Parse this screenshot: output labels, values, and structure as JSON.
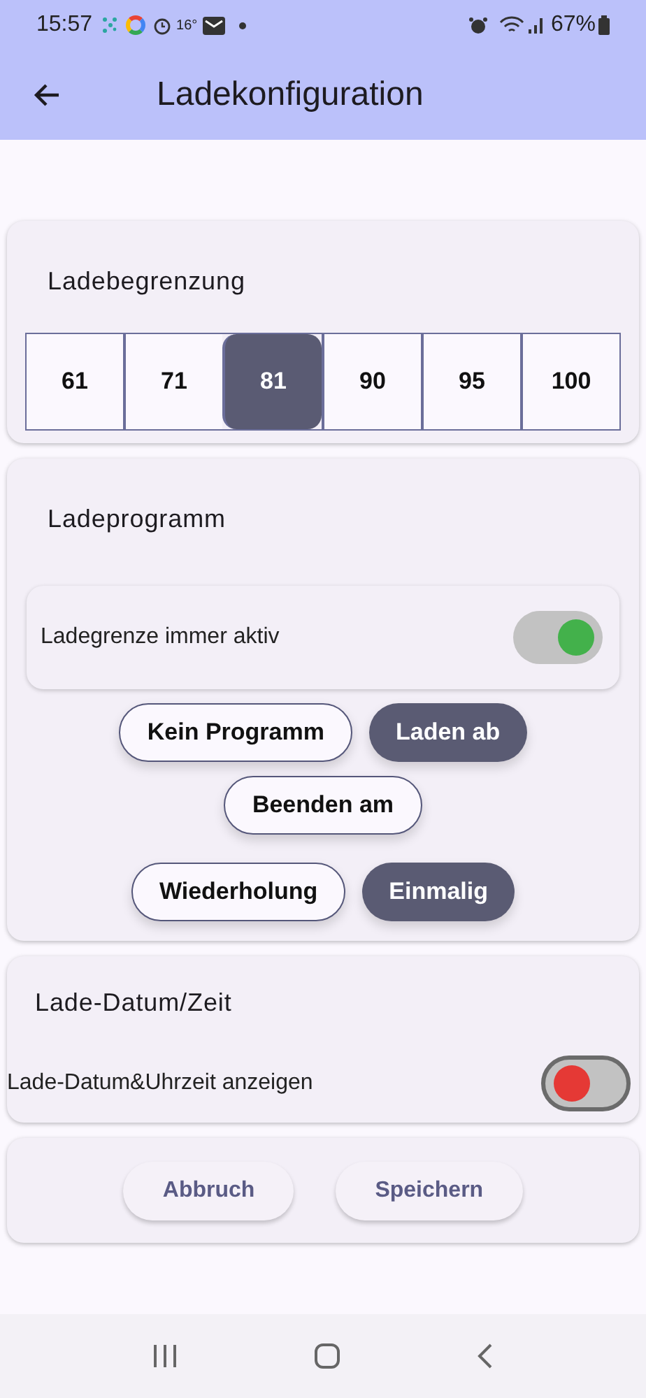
{
  "status_bar": {
    "time": "15:57",
    "temperature": "16°",
    "battery": "67%"
  },
  "app_bar": {
    "title": "Ladekonfiguration"
  },
  "charge_limit": {
    "title": "Ladebegrenzung",
    "options": [
      {
        "label": "61",
        "selected": false
      },
      {
        "label": "71",
        "selected": false
      },
      {
        "label": "81",
        "selected": true
      },
      {
        "label": "90",
        "selected": false
      },
      {
        "label": "95",
        "selected": false
      },
      {
        "label": "100",
        "selected": false
      }
    ]
  },
  "charge_program": {
    "title": "Ladeprogramm",
    "switch": {
      "label": "Ladegrenze immer aktiv",
      "on": true
    },
    "chip_rows": [
      [
        {
          "label": "Kein Programm",
          "selected": false
        },
        {
          "label": "Laden ab",
          "selected": true
        }
      ],
      [
        {
          "label": "Beenden am",
          "selected": false
        }
      ],
      [
        {
          "label": "Wiederholung",
          "selected": false
        },
        {
          "label": "Einmalig",
          "selected": true
        }
      ]
    ]
  },
  "charge_datetime": {
    "title": "Lade-Datum/Zeit",
    "switch": {
      "label": "Lade-Datum&Uhrzeit anzeigen",
      "on": false
    }
  },
  "buttons": [
    "Abbruch",
    "Speichern"
  ]
}
